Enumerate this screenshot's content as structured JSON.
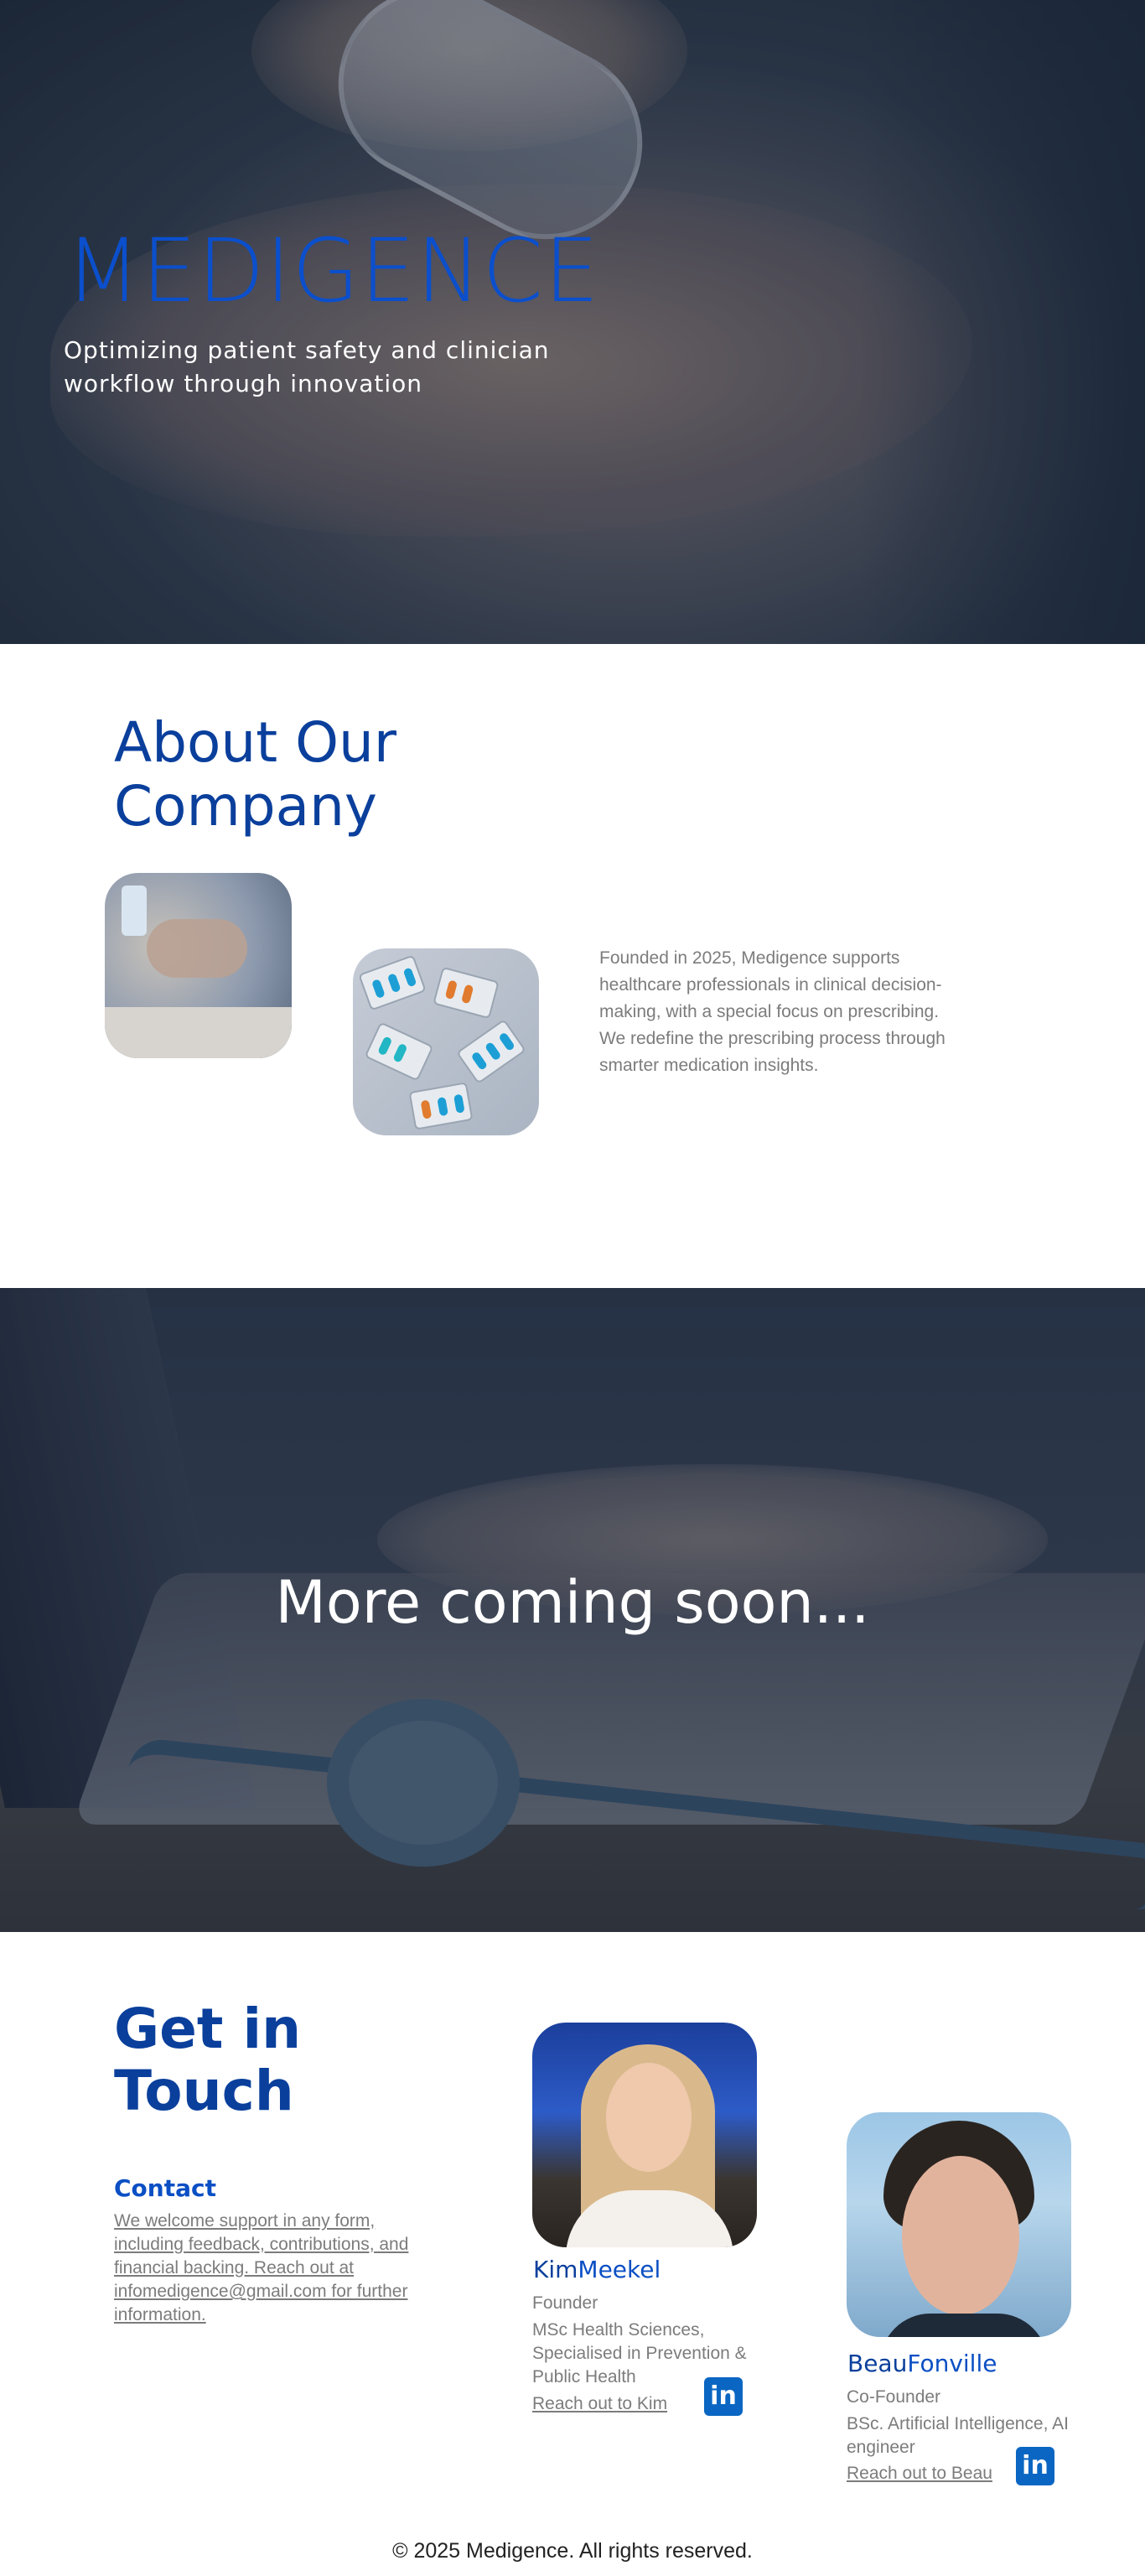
{
  "hero": {
    "title": "MEDIGENCE",
    "subtitle": "Optimizing patient safety and clinician workflow through innovation"
  },
  "about": {
    "title": "About Our Company",
    "text": "Founded in 2025, Medigence supports healthcare professionals in clinical decision-making, with a special focus on prescribing. We redefine the prescribing process through smarter medication insights."
  },
  "coming_soon": {
    "text": "More coming soon..."
  },
  "contact": {
    "title": "Get in Touch",
    "label": "Contact",
    "text": "We welcome support in any form, including feedback, contributions, and financial backing. Reach out at infomedigence@gmail.com for further information."
  },
  "team": [
    {
      "first_name": "Kim",
      "last_name": "Meekel",
      "role": "Founder",
      "description": "MSc Health Sciences, Specialised in Prevention & Public Health",
      "link": "Reach out to Kim",
      "icon": "linkedin-icon"
    },
    {
      "first_name": "Beau",
      "last_name": "Fonville",
      "role": "Co-Founder",
      "description": "BSc. Artificial Intelligence, AI engineer",
      "link": "Reach out to Beau",
      "icon": "linkedin-icon"
    }
  ],
  "footer": {
    "text": "© 2025 Medigence. All rights reserved."
  },
  "colors": {
    "brand_blue": "#0a3f9c",
    "accent_blue": "#0a4fc4",
    "linkedin_blue": "#0a66c2",
    "body_text": "#7c7c7c"
  }
}
